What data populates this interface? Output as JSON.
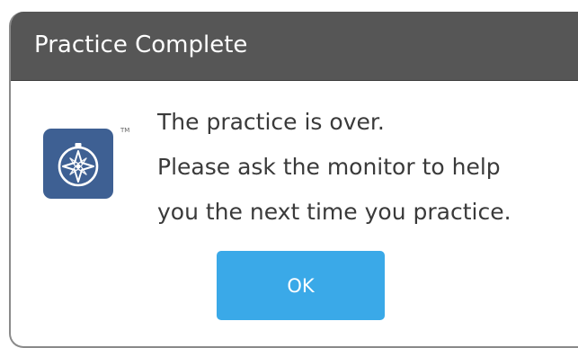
{
  "dialog": {
    "title": "Practice Complete",
    "message_lines": [
      "The practice is over.",
      "Please ask the monitor to help",
      "you the next time you practice."
    ],
    "icon": "compass-icon",
    "trademark": "TM",
    "ok_label": "OK"
  },
  "colors": {
    "titlebar": "#565656",
    "button": "#3aa9e8",
    "icon_bg": "#3e6093"
  }
}
